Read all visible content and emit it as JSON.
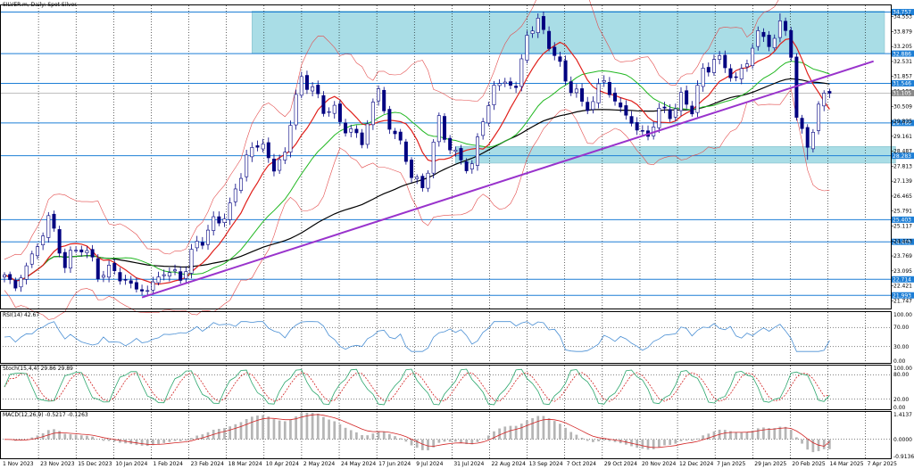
{
  "chart_data": {
    "type": "candlestick",
    "title": "SILVER.m, Daily:  Spot Silver",
    "x_tick_labels": [
      "1 Nov 2023",
      "23 Nov 2023",
      "15 Dec 2023",
      "10 Jan 2024",
      "1 Feb 2024",
      "23 Feb 2024",
      "18 Mar 2024",
      "10 Apr 2024",
      "2 May 2024",
      "24 May 2024",
      "17 Jun 2024",
      "9 Jul 2024",
      "31 Jul 2024",
      "22 Aug 2024",
      "13 Sep 2024",
      "7 Oct 2024",
      "29 Oct 2024",
      "20 Nov 2024",
      "12 Dec 2024",
      "7 Jan 2025",
      "29 Jan 2025",
      "20 Feb 2025",
      "14 Mar 2025",
      "7 Apr 2025"
    ],
    "y_tick_labels": [
      "34.553",
      "33.879",
      "33.205",
      "32.531",
      "31.857",
      "31.183",
      "30.509",
      "29.835",
      "29.161",
      "28.487",
      "27.813",
      "27.139",
      "26.465",
      "25.791",
      "25.117",
      "24.443",
      "23.769",
      "23.095",
      "22.421",
      "21.747"
    ],
    "ylim": [
      21.4,
      35.1
    ],
    "horizontal_levels": [
      {
        "value": 34.757,
        "label": "34.757"
      },
      {
        "value": 32.886,
        "label": "32.886"
      },
      {
        "value": 31.546,
        "label": "31.546"
      },
      {
        "value": 29.76,
        "label": "29.760"
      },
      {
        "value": 28.283,
        "label": "28.283"
      },
      {
        "value": 25.403,
        "label": "25.403"
      },
      {
        "value": 24.405,
        "label": "24.405"
      },
      {
        "value": 22.714,
        "label": "22.714"
      },
      {
        "value": 21.993,
        "label": "21.993"
      }
    ],
    "current_price": {
      "value": 31.105,
      "label": "31.105"
    },
    "zones": [
      {
        "from_index": 45,
        "to_index": 160,
        "top": 34.8,
        "bottom": 32.9
      },
      {
        "from_index": 82,
        "to_index": 162,
        "top": 28.7,
        "bottom": 27.95
      }
    ],
    "trendline": {
      "x1_index": 25,
      "y1": 21.9,
      "x2_index": 150,
      "y2": 31.9
    },
    "anchors": [
      {
        "i": 0,
        "p": 22.8
      },
      {
        "i": 2,
        "p": 22.4
      },
      {
        "i": 6,
        "p": 24.2
      },
      {
        "i": 8,
        "p": 25.5
      },
      {
        "i": 11,
        "p": 23.4
      },
      {
        "i": 14,
        "p": 24.3
      },
      {
        "i": 17,
        "p": 23.0
      },
      {
        "i": 20,
        "p": 23.1
      },
      {
        "i": 23,
        "p": 22.4
      },
      {
        "i": 26,
        "p": 22.2
      },
      {
        "i": 29,
        "p": 23.1
      },
      {
        "i": 32,
        "p": 22.8
      },
      {
        "i": 35,
        "p": 24.3
      },
      {
        "i": 38,
        "p": 25.2
      },
      {
        "i": 41,
        "p": 25.9
      },
      {
        "i": 44,
        "p": 28.3
      },
      {
        "i": 47,
        "p": 28.9
      },
      {
        "i": 49,
        "p": 27.5
      },
      {
        "i": 51,
        "p": 28.6
      },
      {
        "i": 54,
        "p": 31.9
      },
      {
        "i": 56,
        "p": 31.2
      },
      {
        "i": 58,
        "p": 30.5
      },
      {
        "i": 60,
        "p": 30.2
      },
      {
        "i": 63,
        "p": 29.3
      },
      {
        "i": 65,
        "p": 29.0
      },
      {
        "i": 68,
        "p": 31.3
      },
      {
        "i": 70,
        "p": 29.5
      },
      {
        "i": 72,
        "p": 28.9
      },
      {
        "i": 74,
        "p": 27.4
      },
      {
        "i": 76,
        "p": 26.8
      },
      {
        "i": 79,
        "p": 29.8
      },
      {
        "i": 82,
        "p": 28.2
      },
      {
        "i": 85,
        "p": 27.8
      },
      {
        "i": 87,
        "p": 30.0
      },
      {
        "i": 89,
        "p": 31.3
      },
      {
        "i": 91,
        "p": 31.7
      },
      {
        "i": 93,
        "p": 31.3
      },
      {
        "i": 95,
        "p": 33.8
      },
      {
        "i": 97,
        "p": 34.3
      },
      {
        "i": 99,
        "p": 33.4
      },
      {
        "i": 101,
        "p": 32.2
      },
      {
        "i": 103,
        "p": 31.4
      },
      {
        "i": 105,
        "p": 30.6
      },
      {
        "i": 107,
        "p": 30.7
      },
      {
        "i": 109,
        "p": 31.8
      },
      {
        "i": 111,
        "p": 30.6
      },
      {
        "i": 113,
        "p": 30.2
      },
      {
        "i": 115,
        "p": 29.4
      },
      {
        "i": 117,
        "p": 29.2
      },
      {
        "i": 119,
        "p": 30.3
      },
      {
        "i": 121,
        "p": 30.2
      },
      {
        "i": 123,
        "p": 30.8
      },
      {
        "i": 125,
        "p": 30.5
      },
      {
        "i": 127,
        "p": 32.0
      },
      {
        "i": 129,
        "p": 32.7
      },
      {
        "i": 131,
        "p": 32.3
      },
      {
        "i": 133,
        "p": 31.7
      },
      {
        "i": 135,
        "p": 32.5
      },
      {
        "i": 137,
        "p": 33.9
      },
      {
        "i": 139,
        "p": 33.2
      },
      {
        "i": 141,
        "p": 34.3
      },
      {
        "i": 142,
        "p": 33.7
      },
      {
        "i": 143,
        "p": 32.9
      },
      {
        "i": 144,
        "p": 30.2
      },
      {
        "i": 145,
        "p": 29.2
      },
      {
        "i": 146,
        "p": 28.6
      },
      {
        "i": 147,
        "p": 29.7
      },
      {
        "i": 148,
        "p": 30.5
      },
      {
        "i": 150,
        "p": 31.1
      }
    ],
    "rsi": {
      "label": "RSI(14) 42.67",
      "levels": [
        "100.00",
        "70.00",
        "30.00",
        "0.00"
      ],
      "min": 0,
      "max": 100
    },
    "stoch": {
      "label": "Stoch(15,4,4) 29.86 29.89",
      "levels": [
        "100.00",
        "80.00",
        "20.00",
        "0.00"
      ],
      "min": 0,
      "max": 100
    },
    "macd": {
      "label": "MACD(12,26,9) -0.5217 -0.1263",
      "levels": [
        "1.4137",
        "0.0000",
        "-0.9136"
      ],
      "min": -0.9136,
      "max": 1.4137
    },
    "colors": {
      "background": "#ffffff",
      "zone": "#a9dde6",
      "level_line": "#1e7fd6",
      "trendline": "#9933cc",
      "candle": "#000080",
      "ma_fast": "#e0201b",
      "ma_mid": "#22b822",
      "ma_slow": "#000000",
      "bollinger": "#e34b4b",
      "rsi_line": "#4a8fd4",
      "stoch_main": "#2aa66c",
      "stoch_signal": "#d22222",
      "macd_hist": "#b5b5b5",
      "macd_signal": "#d22222"
    }
  }
}
